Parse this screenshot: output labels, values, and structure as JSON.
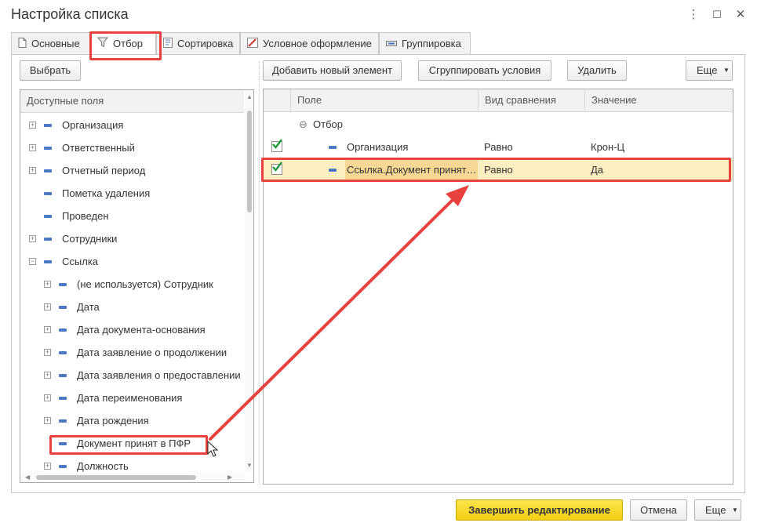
{
  "window": {
    "title": "Настройка списка",
    "more_icon": "⋮",
    "maximize_icon": "☐",
    "close_icon": "✕"
  },
  "tabs": [
    {
      "label": "Основные",
      "icon": "page-icon"
    },
    {
      "label": "Отбор",
      "icon": "filter-icon"
    },
    {
      "label": "Сортировка",
      "icon": "sort-icon"
    },
    {
      "label": "Условное оформление",
      "icon": "format-icon"
    },
    {
      "label": "Группировка",
      "icon": "group-icon"
    }
  ],
  "left_toolbar": {
    "select_label": "Выбрать"
  },
  "right_toolbar": {
    "add_label": "Добавить новый элемент",
    "group_label": "Сгруппировать условия",
    "delete_label": "Удалить",
    "more_label": "Еще"
  },
  "available_fields": {
    "header": "Доступные поля",
    "items": [
      {
        "label": "Организация",
        "expandable": true,
        "level": 0
      },
      {
        "label": "Ответственный",
        "expandable": true,
        "level": 0
      },
      {
        "label": "Отчетный период",
        "expandable": true,
        "level": 0
      },
      {
        "label": "Пометка удаления",
        "expandable": false,
        "level": 0
      },
      {
        "label": "Проведен",
        "expandable": false,
        "level": 0
      },
      {
        "label": "Сотрудники",
        "expandable": true,
        "level": 0
      },
      {
        "label": "Ссылка",
        "expandable": true,
        "expanded": true,
        "level": 0
      },
      {
        "label": "(не используется) Сотрудник",
        "expandable": true,
        "level": 1
      },
      {
        "label": "Дата",
        "expandable": true,
        "level": 1
      },
      {
        "label": "Дата документа-основания",
        "expandable": true,
        "level": 1
      },
      {
        "label": "Дата заявление о продолжении",
        "expandable": true,
        "level": 1
      },
      {
        "label": "Дата заявления о предоставлении",
        "expandable": true,
        "level": 1
      },
      {
        "label": "Дата переименования",
        "expandable": true,
        "level": 1
      },
      {
        "label": "Дата рождения",
        "expandable": true,
        "level": 1
      },
      {
        "label": "Документ принят в ПФР",
        "expandable": false,
        "level": 1
      },
      {
        "label": "Должность",
        "expandable": true,
        "level": 1
      }
    ]
  },
  "filter_grid": {
    "columns": [
      "Поле",
      "Вид сравнения",
      "Значение"
    ],
    "group_label": "Отбор",
    "rows": [
      {
        "checked": true,
        "field": "Организация",
        "comparison": "Равно",
        "value": "Крон-Ц"
      },
      {
        "checked": true,
        "field": "Ссылка.Документ принят в ПФР",
        "comparison": "Равно",
        "value": "Да"
      }
    ]
  },
  "footer": {
    "finish_label": "Завершить редактирование",
    "cancel_label": "Отмена",
    "more_label": "Еще"
  },
  "colors": {
    "accent_red": "#e8423f",
    "selection": "#fbeec0",
    "primary_button": "#f2cf12",
    "check_green": "#1e9b3a",
    "field_icon_blue": "#4a78c2"
  }
}
